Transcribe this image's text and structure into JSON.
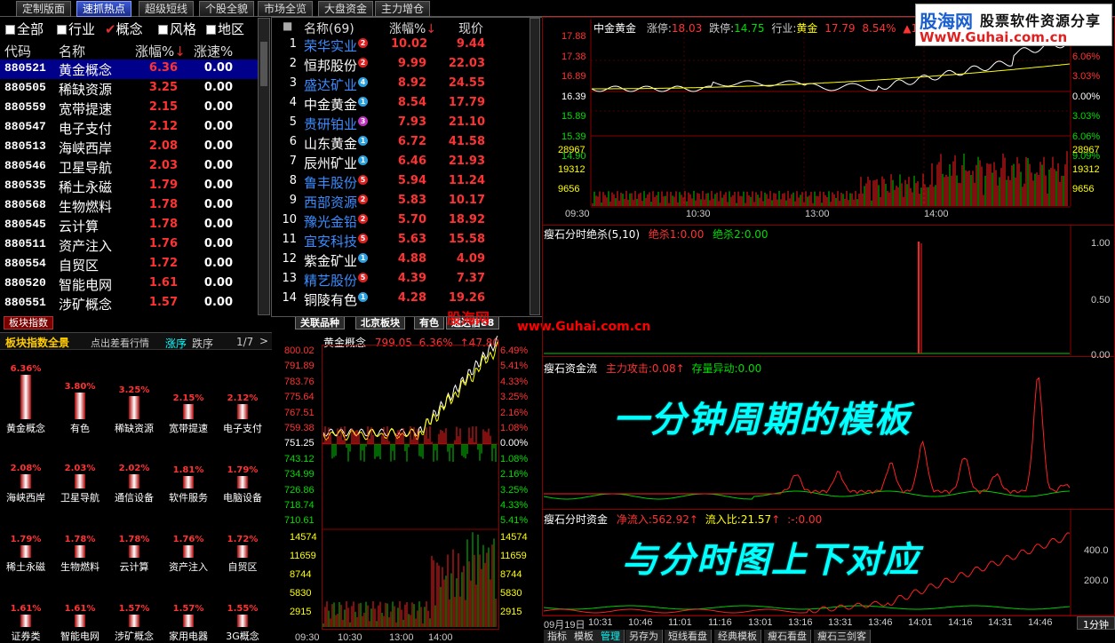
{
  "top_tabs": [
    "定制版面",
    "速抓热点",
    "超级短线",
    "个股全貌",
    "市场全览",
    "大盘资金",
    "主力增仓"
  ],
  "filters": [
    "全部",
    "行业",
    "概念",
    "风格",
    "地区"
  ],
  "left_table": {
    "headers": [
      "代码",
      "名称",
      "涨幅%",
      "涨速%"
    ],
    "rows": [
      {
        "code": "880521",
        "name": "黄金概念",
        "pct": "6.36",
        "speed": "0.00"
      },
      {
        "code": "880505",
        "name": "稀缺资源",
        "pct": "3.25",
        "speed": "0.00"
      },
      {
        "code": "880559",
        "name": "宽带提速",
        "pct": "2.15",
        "speed": "0.00"
      },
      {
        "code": "880547",
        "name": "电子支付",
        "pct": "2.12",
        "speed": "0.00"
      },
      {
        "code": "880513",
        "name": "海峡西岸",
        "pct": "2.08",
        "speed": "0.00"
      },
      {
        "code": "880546",
        "name": "卫星导航",
        "pct": "2.03",
        "speed": "0.00"
      },
      {
        "code": "880535",
        "name": "稀土永磁",
        "pct": "1.79",
        "speed": "0.00"
      },
      {
        "code": "880568",
        "name": "生物燃料",
        "pct": "1.78",
        "speed": "0.00"
      },
      {
        "code": "880545",
        "name": "云计算",
        "pct": "1.78",
        "speed": "0.00"
      },
      {
        "code": "880511",
        "name": "资产注入",
        "pct": "1.76",
        "speed": "0.00"
      },
      {
        "code": "880554",
        "name": "自贸区",
        "pct": "1.72",
        "speed": "0.00"
      },
      {
        "code": "880520",
        "name": "智能电网",
        "pct": "1.61",
        "speed": "0.00"
      },
      {
        "code": "880551",
        "name": "涉矿概念",
        "pct": "1.57",
        "speed": "0.00"
      }
    ]
  },
  "sector_tab": "板块指数",
  "sector_panel": {
    "title": "板块指数全景",
    "subtitle": "点出差看行情",
    "sort_up": "涨序",
    "sort_down": "跌序",
    "page": "1/7",
    "items": [
      {
        "pct": "6.36%",
        "name": "黄金概念",
        "v": 6.36
      },
      {
        "pct": "3.80%",
        "name": "有色",
        "v": 3.8
      },
      {
        "pct": "3.25%",
        "name": "稀缺资源",
        "v": 3.25
      },
      {
        "pct": "2.15%",
        "name": "宽带提速",
        "v": 2.15
      },
      {
        "pct": "2.12%",
        "name": "电子支付",
        "v": 2.12
      },
      {
        "pct": "2.08%",
        "name": "海峡西岸",
        "v": 2.08
      },
      {
        "pct": "2.03%",
        "name": "卫星导航",
        "v": 2.03
      },
      {
        "pct": "2.02%",
        "name": "通信设备",
        "v": 2.02
      },
      {
        "pct": "1.81%",
        "name": "软件服务",
        "v": 1.81
      },
      {
        "pct": "1.79%",
        "name": "电脑设备",
        "v": 1.79
      },
      {
        "pct": "1.79%",
        "name": "稀土永磁",
        "v": 1.79
      },
      {
        "pct": "1.78%",
        "name": "生物燃料",
        "v": 1.78
      },
      {
        "pct": "1.78%",
        "name": "云计算",
        "v": 1.78
      },
      {
        "pct": "1.76%",
        "name": "资产注入",
        "v": 1.76
      },
      {
        "pct": "1.72%",
        "name": "自贸区",
        "v": 1.72
      },
      {
        "pct": "1.61%",
        "name": "证券类",
        "v": 1.61
      },
      {
        "pct": "1.61%",
        "name": "智能电网",
        "v": 1.61
      },
      {
        "pct": "1.57%",
        "name": "涉矿概念",
        "v": 1.57
      },
      {
        "pct": "1.57%",
        "name": "家用电器",
        "v": 1.57
      },
      {
        "pct": "1.55%",
        "name": "3G概念",
        "v": 1.55
      }
    ]
  },
  "mid_table": {
    "headers": [
      "名称(69)",
      "涨幅%",
      "现价"
    ],
    "rows": [
      {
        "num": "1",
        "name": "荣华实业",
        "pct": "10.02",
        "price": "9.44",
        "badge": "2",
        "bc": "#e02020",
        "nc": "#3b8cff"
      },
      {
        "num": "2",
        "name": "恒邦股份",
        "pct": "9.99",
        "price": "22.03",
        "badge": "2",
        "bc": "#e02020",
        "nc": "#fff"
      },
      {
        "num": "3",
        "name": "盛达矿业",
        "pct": "8.92",
        "price": "24.55",
        "badge": "4",
        "bc": "#2aa0e0",
        "nc": "#3b8cff"
      },
      {
        "num": "4",
        "name": "中金黄金",
        "pct": "8.54",
        "price": "17.79",
        "badge": "1",
        "bc": "#2aa0e0",
        "nc": "#fff"
      },
      {
        "num": "5",
        "name": "贵研铂业",
        "pct": "7.93",
        "price": "21.10",
        "badge": "3",
        "bc": "#c030c0",
        "nc": "#3b8cff"
      },
      {
        "num": "6",
        "name": "山东黄金",
        "pct": "6.72",
        "price": "41.58",
        "badge": "1",
        "bc": "#2aa0e0",
        "nc": "#fff"
      },
      {
        "num": "7",
        "name": "辰州矿业",
        "pct": "6.46",
        "price": "21.93",
        "badge": "1",
        "bc": "#2aa0e0",
        "nc": "#fff"
      },
      {
        "num": "8",
        "name": "鲁丰股份",
        "pct": "5.94",
        "price": "11.24",
        "badge": "5",
        "bc": "#e02020",
        "nc": "#3b8cff"
      },
      {
        "num": "9",
        "name": "西部资源",
        "pct": "5.83",
        "price": "10.17",
        "badge": "2",
        "bc": "#e02020",
        "nc": "#3b8cff"
      },
      {
        "num": "10",
        "name": "豫光金铅",
        "pct": "5.70",
        "price": "18.92",
        "badge": "2",
        "bc": "#e02020",
        "nc": "#3b8cff"
      },
      {
        "num": "11",
        "name": "宜安科技",
        "pct": "5.63",
        "price": "15.58",
        "badge": "5",
        "bc": "#e02020",
        "nc": "#3b8cff"
      },
      {
        "num": "12",
        "name": "紫金矿业",
        "pct": "4.88",
        "price": "4.09",
        "badge": "1",
        "bc": "#2aa0e0",
        "nc": "#fff"
      },
      {
        "num": "13",
        "name": "精艺股份",
        "pct": "4.39",
        "price": "7.37",
        "badge": "5",
        "bc": "#e02020",
        "nc": "#3b8cff"
      },
      {
        "num": "14",
        "name": "铜陵有色",
        "pct": "4.28",
        "price": "19.26",
        "badge": "1",
        "bc": "#2aa0e0",
        "nc": "#fff"
      }
    ]
  },
  "mid_tabs": [
    "关联品种",
    "北京板块",
    "有色",
    "通达信88"
  ],
  "watermark_mid": "股海网",
  "watermark_url": "www.Guhai.com.cn",
  "index_chart": {
    "title": "黄金概念",
    "price": "799.05",
    "pct": "6.36%",
    "chg": "↑47.80",
    "y_left": [
      "800.02",
      "791.89",
      "783.76",
      "775.64",
      "767.51",
      "759.38",
      "751.25",
      "743.12",
      "734.99",
      "726.86",
      "718.74",
      "710.61"
    ],
    "y_right": [
      "6.49%",
      "5.41%",
      "4.33%",
      "3.25%",
      "2.16%",
      "1.08%",
      "0.00%",
      "1.08%",
      "2.16%",
      "3.25%",
      "4.33%",
      "5.41%"
    ],
    "vol_left": [
      "14574",
      "11659",
      "8744",
      "5830",
      "2915"
    ],
    "vol_right": [
      "14574",
      "11659",
      "8744",
      "5830",
      "2915"
    ],
    "times": [
      "09:30",
      "10:30",
      "13:00",
      "14:00"
    ]
  },
  "stock_chart": {
    "name": "中金黄金",
    "limit_up_label": "涨停:",
    "limit_up": "18.03",
    "limit_down_label": "跌停:",
    "limit_down": "14.75",
    "industry_label": "行业:",
    "industry": "黄金",
    "price": "17.79",
    "pct": "8.54%",
    "chg": "▲1.40",
    "y_left": [
      "17.88",
      "17.38",
      "16.89",
      "16.39",
      "15.89",
      "15.39",
      "14.90"
    ],
    "y_right": [
      "9.09%",
      "6.06%",
      "3.03%",
      "0.00%",
      "3.03%",
      "6.06%",
      "9.09%"
    ],
    "vol_left": [
      "28967",
      "19312",
      "9656"
    ],
    "vol_right": [
      "28967",
      "19312",
      "9656"
    ],
    "times": [
      "09:30",
      "10:30",
      "13:00",
      "14:00"
    ]
  },
  "logo": {
    "cn": "股海网",
    "sub": "股票软件资源分享",
    "url": "WwW.Guhai.com.cn"
  },
  "ind1": {
    "title": "瘦石分时绝杀(5,10)",
    "l1": "绝杀1:",
    "v1": "0.00",
    "l2": "绝杀2:",
    "v2": "0.00",
    "y": [
      "1.00",
      "0.50",
      "0.00"
    ]
  },
  "ind2": {
    "title": "瘦石资金流",
    "l1": "主力攻击:",
    "v1": "0.08",
    "l2": "存量异动:",
    "v2": "0.00"
  },
  "ind3": {
    "title": "瘦石分时资金",
    "l1": "净流入:",
    "v1": "562.92",
    "l2": "流入比:",
    "v2": "21.57",
    "l3": ":-",
    "v3": ":0.00",
    "y": [
      "400.0",
      "200.0"
    ]
  },
  "overlay1": "一分钟周期的模板",
  "overlay2": "与分时图上下对应",
  "time_axis": [
    "09月19日",
    "10:31",
    "10:46",
    "11:01",
    "11:16",
    "13:01",
    "13:16",
    "13:31",
    "13:46",
    "14:01",
    "14:16",
    "14:31",
    "14:46"
  ],
  "period": "1分钟",
  "bottom_tabs": [
    "指标",
    "模板",
    "管理",
    "另存为",
    "短线看盘",
    "经典模板",
    "瘦石看盘",
    "瘦石三剑客"
  ],
  "colors": {
    "up": "#ff3333",
    "down": "#00cc00",
    "cyan": "#00ffff",
    "yellow": "#ffff00"
  }
}
